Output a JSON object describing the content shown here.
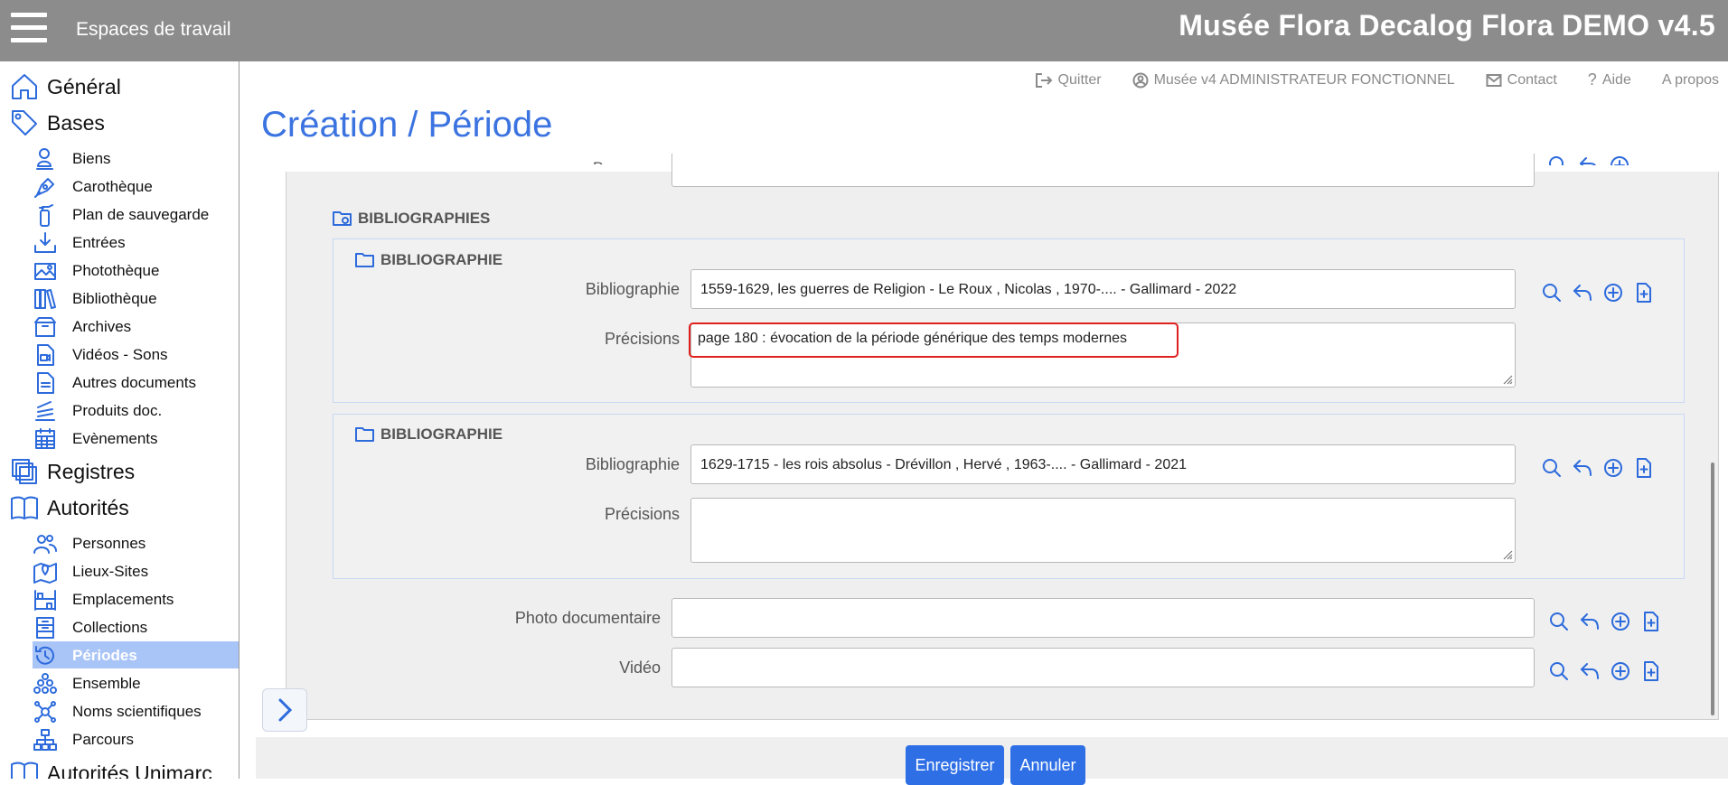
{
  "topbar": {
    "workspaces_label": "Espaces de travail",
    "app_title": "Musée Flora Decalog Flora DEMO v4.5"
  },
  "header_links": {
    "quit": "Quitter",
    "user": "Musée v4 ADMINISTRATEUR FONCTIONNEL",
    "contact": "Contact",
    "help": "Aide",
    "about": "A propos"
  },
  "page_title": "Création / Période",
  "sidebar": {
    "general": "Général",
    "bases": "Bases",
    "bases_items": [
      "Biens",
      "Carothèque",
      "Plan de sauvegarde",
      "Entrées",
      "Photothèque",
      "Bibliothèque",
      "Archives",
      "Vidéos - Sons",
      "Autres documents",
      "Produits doc.",
      "Evènements"
    ],
    "registres": "Registres",
    "autorites": "Autorités",
    "autorites_items": [
      "Personnes",
      "Lieux-Sites",
      "Emplacements",
      "Collections",
      "Périodes",
      "Ensemble",
      "Noms scientifiques",
      "Parcours"
    ],
    "active_item": "Périodes",
    "autorites_unimarc": "Autorités Unimarc"
  },
  "form": {
    "partial_label": "Personne",
    "bibliographies_header": "BIBLIOGRAPHIES",
    "entries": [
      {
        "header": "BIBLIOGRAPHIE",
        "bibliographie_label": "Bibliographie",
        "bibliographie_value": "1559-1629, les guerres de Religion - Le Roux , Nicolas , 1970-.... - Gallimard - 2022",
        "precisions_label": "Précisions",
        "precisions_value": "page 180 : évocation de la période générique des temps modernes"
      },
      {
        "header": "BIBLIOGRAPHIE",
        "bibliographie_label": "Bibliographie",
        "bibliographie_value": "1629-1715 - les rois absolus - Drévillon , Hervé , 1963-.... - Gallimard - 2021",
        "precisions_label": "Précisions",
        "precisions_value": ""
      }
    ],
    "photo_label": "Photo documentaire",
    "photo_value": "",
    "video_label": "Vidéo",
    "video_value": ""
  },
  "buttons": {
    "save": "Enregistrer",
    "cancel": "Annuler"
  },
  "colors": {
    "accent": "#2e6fe6",
    "title": "#3b73e0",
    "topbar": "#8c8c8c",
    "highlight": "#e0201c",
    "active_item_bg": "#a9c4f7"
  }
}
